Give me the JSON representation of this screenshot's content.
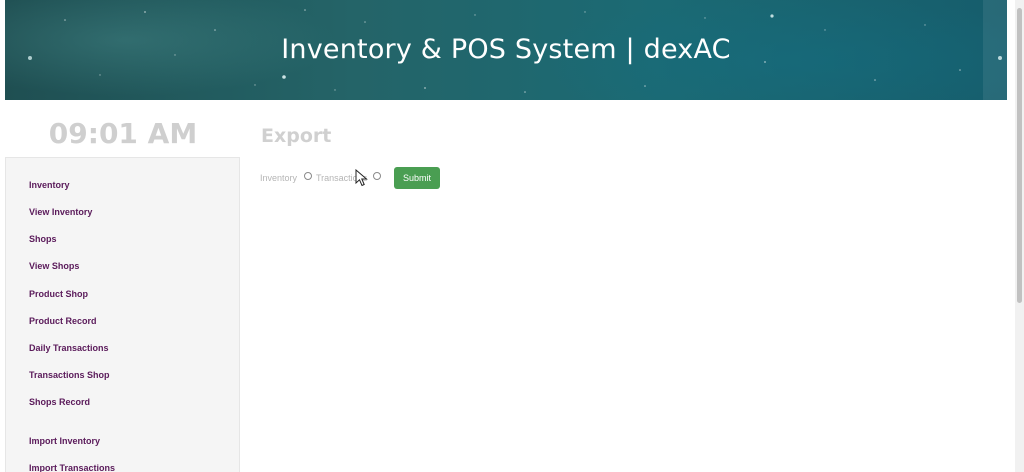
{
  "header": {
    "title": "Inventory & POS System | dexAC"
  },
  "clock": {
    "time": "09:01 AM"
  },
  "sidebar": {
    "items": [
      {
        "label": "Inventory"
      },
      {
        "label": "View Inventory"
      },
      {
        "label": "Shops"
      },
      {
        "label": "View Shops"
      },
      {
        "label": "Product Shop"
      },
      {
        "label": "Product Record"
      },
      {
        "label": "Daily Transactions"
      },
      {
        "label": "Transactions Shop"
      },
      {
        "label": "Shops Record"
      },
      {
        "label": "Import Inventory"
      },
      {
        "label": "Import Transactions"
      }
    ]
  },
  "main": {
    "title": "Export",
    "options": [
      {
        "label": "Inventory",
        "selected": false
      },
      {
        "label": "Transactions",
        "selected": false
      }
    ],
    "submit_label": "Submit"
  },
  "colors": {
    "header_bg": "#1f5a60",
    "nav_link": "#5a1a5a",
    "submit_button": "#4a9e52",
    "clock_text": "#cfcfcf"
  },
  "icons": {
    "cursor": "mouse-pointer-icon"
  }
}
